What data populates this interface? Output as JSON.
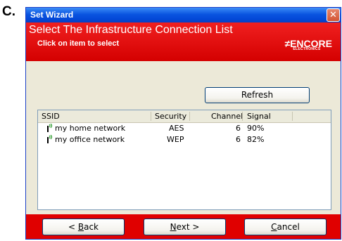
{
  "figure_label": "C.",
  "window": {
    "title": "Set Wizard",
    "close_icon": "close-icon"
  },
  "banner": {
    "heading": "Select The Infrastructure Connection List",
    "subheading": "Click on item to select",
    "logo": {
      "mark": "≠",
      "name": "ENCORE",
      "tagline": "ELECTRONICS"
    },
    "colors": {
      "background": "#d40000",
      "text": "#ffffff"
    }
  },
  "refresh_button": {
    "label": "Refresh"
  },
  "network_list": {
    "columns": [
      "SSID",
      "Security",
      "Channel",
      "Signal"
    ],
    "rows": [
      {
        "ssid": "my home network",
        "security": "AES",
        "channel": "6",
        "signal": "90%",
        "icon": "wifi-signal-icon"
      },
      {
        "ssid": "my office network",
        "security": "WEP",
        "channel": "6",
        "signal": "82%",
        "icon": "wifi-signal-icon"
      }
    ]
  },
  "footer": {
    "back_prefix": "< ",
    "back_accel": "B",
    "back_rest": "ack",
    "next_accel": "N",
    "next_rest": "ext >",
    "cancel_accel": "C",
    "cancel_rest": "ancel",
    "color": "#e00000"
  }
}
